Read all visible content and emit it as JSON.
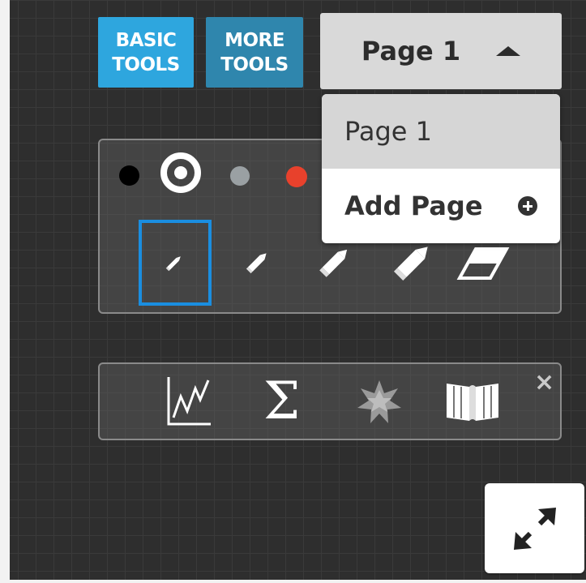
{
  "toolbar": {
    "basic_tools": [
      "BASIC",
      "TOOLS"
    ],
    "more_tools": [
      "MORE",
      "TOOLS"
    ]
  },
  "page_select": {
    "current": "Page 1",
    "options": [
      {
        "label": "Page 1",
        "selected": true
      },
      {
        "label": "Add Page",
        "icon": "plus-circle-icon"
      }
    ]
  },
  "pen_panel": {
    "colors": [
      {
        "name": "black",
        "hex": "#000000"
      },
      {
        "name": "white",
        "hex": "#ffffff",
        "selected": true
      },
      {
        "name": "gray",
        "hex": "#9aa0a3"
      },
      {
        "name": "red",
        "hex": "#e8412c"
      }
    ],
    "tools": [
      "pen-thin-icon",
      "pen-medium-icon",
      "pen-large-icon",
      "pen-xlarge-icon",
      "eraser-icon"
    ],
    "selected_tool": "pen-thin-icon"
  },
  "tools_panel": {
    "items": [
      "graph-icon",
      "sigma-icon",
      "wolfram-alpha-icon",
      "book-icon"
    ],
    "sigma_glyph": "Σ",
    "close_glyph": "×"
  },
  "expand_button": {
    "icon": "expand-arrows-icon"
  },
  "colors": {
    "accent_blue": "#2ea6de",
    "more_blue": "#2f86ad",
    "selection_blue": "#1a8ee0"
  }
}
